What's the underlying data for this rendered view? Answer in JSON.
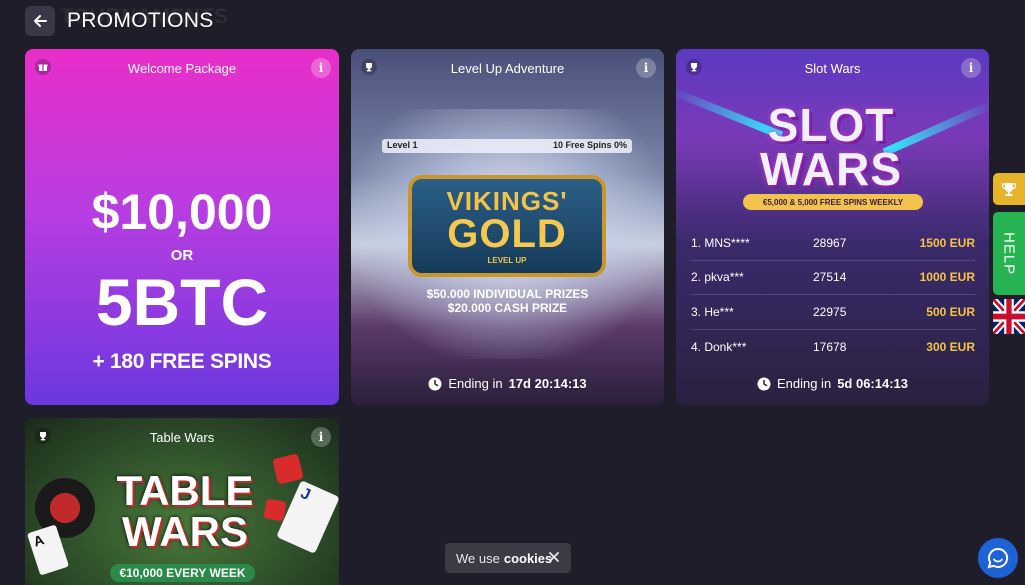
{
  "header": {
    "ghost_title": "TOURNAMENTS",
    "title": "PROMOTIONS"
  },
  "cards": {
    "welcome": {
      "title": "Welcome Package",
      "amount": "$10,000",
      "or": "OR",
      "btc": "5BTC",
      "spins": "+ 180 FREE SPINS"
    },
    "vikings": {
      "title": "Level Up Adventure",
      "progress_level": "Level 1",
      "progress_spins": "10 Free Spins 0%",
      "progress_value": 0,
      "logo_line1": "VIKINGS'",
      "logo_line2": "GOLD",
      "logo_line3": "LEVEL UP",
      "prize1": "$50.000 INDIVIDUAL PRIZES",
      "prize2": "$20.000 CASH PRIZE",
      "timer_label": "Ending in",
      "timer_value": "17d 20:14:13"
    },
    "slotwars": {
      "title": "Slot Wars",
      "logo_line1": "SLOT",
      "logo_line2": "WARS",
      "ribbon": "€5,000 & 5,000 FREE SPINS WEEKLY",
      "leaderboard": [
        {
          "name": "1. MNS****",
          "score": "28967",
          "prize": "1500 EUR"
        },
        {
          "name": "2. pkva***",
          "score": "27514",
          "prize": "1000 EUR"
        },
        {
          "name": "3. He***",
          "score": "22975",
          "prize": "500 EUR"
        },
        {
          "name": "4. Donk***",
          "score": "17678",
          "prize": "300 EUR"
        }
      ],
      "timer_label": "Ending in",
      "timer_value": "5d 06:14:13"
    },
    "tablewars": {
      "title": "Table Wars",
      "logo_line1": "TABLE",
      "logo_line2": "WARS",
      "ribbon": "€10,000 EVERY WEEK",
      "card_a": "A",
      "card_j": "J"
    }
  },
  "side": {
    "help": "HELP"
  },
  "cookie": {
    "text": "We use",
    "bold": "cookies"
  },
  "icons": {
    "back": "arrow-left-icon",
    "info": "info-icon",
    "trophy": "trophy-icon",
    "gift": "gift-icon",
    "clock": "clock-icon",
    "close": "close-icon",
    "chat": "chat-icon",
    "flag": "uk-flag-icon"
  },
  "colors": {
    "background": "#201d2a",
    "gold": "#f6c443",
    "help_green": "#27b351",
    "trophy_tab": "#e5b42a",
    "chat_blue": "#1e63d6"
  }
}
